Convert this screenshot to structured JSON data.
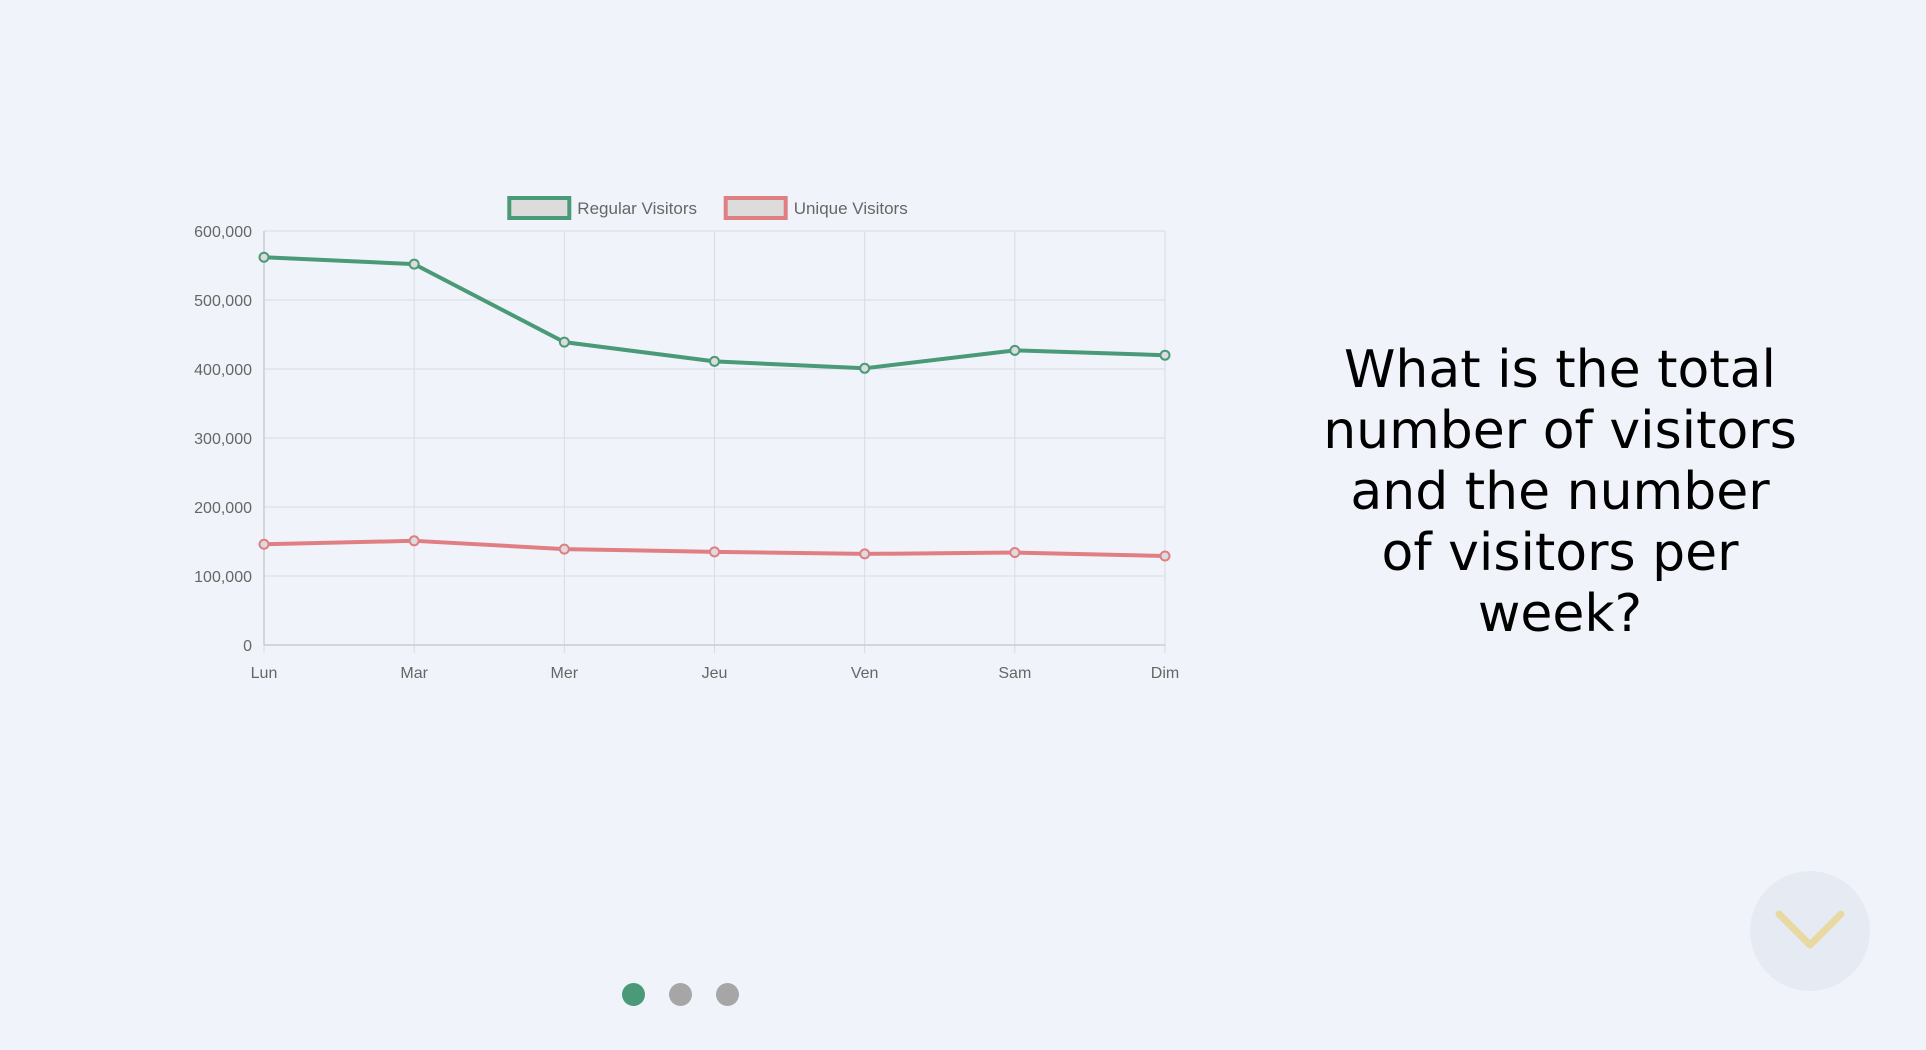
{
  "question": {
    "text": "What is the total number of visitors and the number of visitors per week?"
  },
  "pagination": {
    "count": 3,
    "active_index": 0,
    "active_color": "#4a9a78",
    "inactive_color": "#a6a6a6"
  },
  "next_button": {
    "icon": "chevron-down-icon",
    "icon_color": "#e8d9a2"
  },
  "chart_data": {
    "type": "line",
    "categories": [
      "Lun",
      "Mar",
      "Mer",
      "Jeu",
      "Ven",
      "Sam",
      "Dim"
    ],
    "ylim": [
      0,
      600000
    ],
    "yticks": [
      0,
      100000,
      200000,
      300000,
      400000,
      500000,
      600000
    ],
    "ytick_labels": [
      "0",
      "100,000",
      "200,000",
      "300,000",
      "400,000",
      "500,000",
      "600,000"
    ],
    "grid": true,
    "legend_position": "top",
    "series": [
      {
        "name": "Regular Visitors",
        "color": "#4a9a78",
        "values": [
          562000,
          552000,
          439000,
          411000,
          401000,
          427000,
          420000
        ]
      },
      {
        "name": "Unique Visitors",
        "color": "#e07f83",
        "values": [
          146000,
          151000,
          139000,
          135000,
          132000,
          134000,
          129000
        ]
      }
    ]
  }
}
